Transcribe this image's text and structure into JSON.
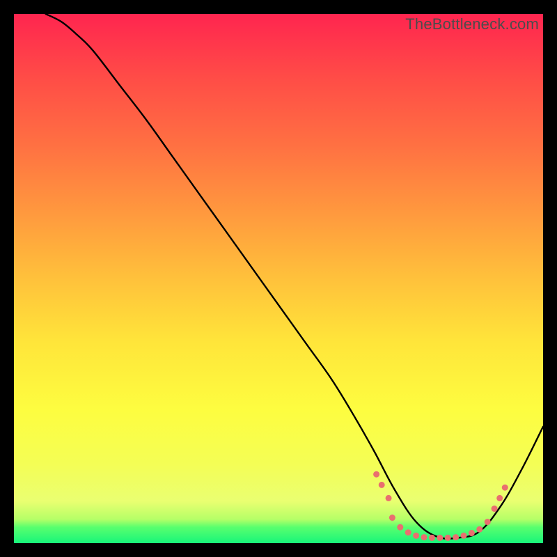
{
  "watermark": "TheBottleneck.com",
  "chart_data": {
    "type": "line",
    "title": "",
    "xlabel": "",
    "ylabel": "",
    "xlim": [
      0,
      100
    ],
    "ylim": [
      0,
      100
    ],
    "grid": false,
    "legend": false,
    "note": "Axes are not labeled; x/y are percentage of plot width/height. y increases upward, so 0 is bottom (green), 100 is top (red). The black curve represents bottleneck percentage dropping from ~100 at the left to a flat minimum near ~0 around x 72–88, then rising again toward the right.",
    "series": [
      {
        "name": "bottleneck-curve",
        "color": "#000000",
        "x": [
          6,
          9,
          12,
          15,
          20,
          25,
          30,
          35,
          40,
          45,
          50,
          55,
          60,
          64,
          68,
          72,
          76,
          80,
          84,
          88,
          92,
          96,
          100
        ],
        "y": [
          100,
          98.5,
          96,
          93,
          86.5,
          80,
          73,
          66,
          59,
          52,
          45,
          38,
          31,
          24.5,
          17.5,
          10,
          4,
          1.2,
          1.0,
          2.2,
          7,
          14,
          22
        ]
      }
    ],
    "markers": {
      "name": "highlight-dots",
      "color": "#e96f6f",
      "radius_px": 4.5,
      "note": "Cluster of salmon dots near the curve minimum; positions approximate.",
      "points": [
        {
          "x": 68.5,
          "y": 13.0
        },
        {
          "x": 69.5,
          "y": 11.0
        },
        {
          "x": 70.8,
          "y": 8.5
        },
        {
          "x": 71.5,
          "y": 4.8
        },
        {
          "x": 73.0,
          "y": 3.0
        },
        {
          "x": 74.5,
          "y": 2.0
        },
        {
          "x": 76.0,
          "y": 1.4
        },
        {
          "x": 77.5,
          "y": 1.1
        },
        {
          "x": 79.0,
          "y": 1.0
        },
        {
          "x": 80.5,
          "y": 1.0
        },
        {
          "x": 82.0,
          "y": 1.0
        },
        {
          "x": 83.5,
          "y": 1.1
        },
        {
          "x": 85.0,
          "y": 1.4
        },
        {
          "x": 86.5,
          "y": 1.9
        },
        {
          "x": 88.0,
          "y": 2.6
        },
        {
          "x": 89.5,
          "y": 4.0
        },
        {
          "x": 90.8,
          "y": 6.5
        },
        {
          "x": 91.8,
          "y": 8.5
        },
        {
          "x": 92.8,
          "y": 10.5
        }
      ]
    },
    "gradient_stops": [
      {
        "pos": 0,
        "color": "#ff254f"
      },
      {
        "pos": 0.12,
        "color": "#ff4c47"
      },
      {
        "pos": 0.25,
        "color": "#ff7142"
      },
      {
        "pos": 0.38,
        "color": "#ff9a3e"
      },
      {
        "pos": 0.5,
        "color": "#ffc13b"
      },
      {
        "pos": 0.62,
        "color": "#ffe53a"
      },
      {
        "pos": 0.75,
        "color": "#fdfd40"
      },
      {
        "pos": 0.85,
        "color": "#f4fe55"
      },
      {
        "pos": 0.92,
        "color": "#eaff71"
      },
      {
        "pos": 0.955,
        "color": "#b6ff67"
      },
      {
        "pos": 0.97,
        "color": "#59ff6e"
      },
      {
        "pos": 1.0,
        "color": "#17f57a"
      }
    ]
  }
}
